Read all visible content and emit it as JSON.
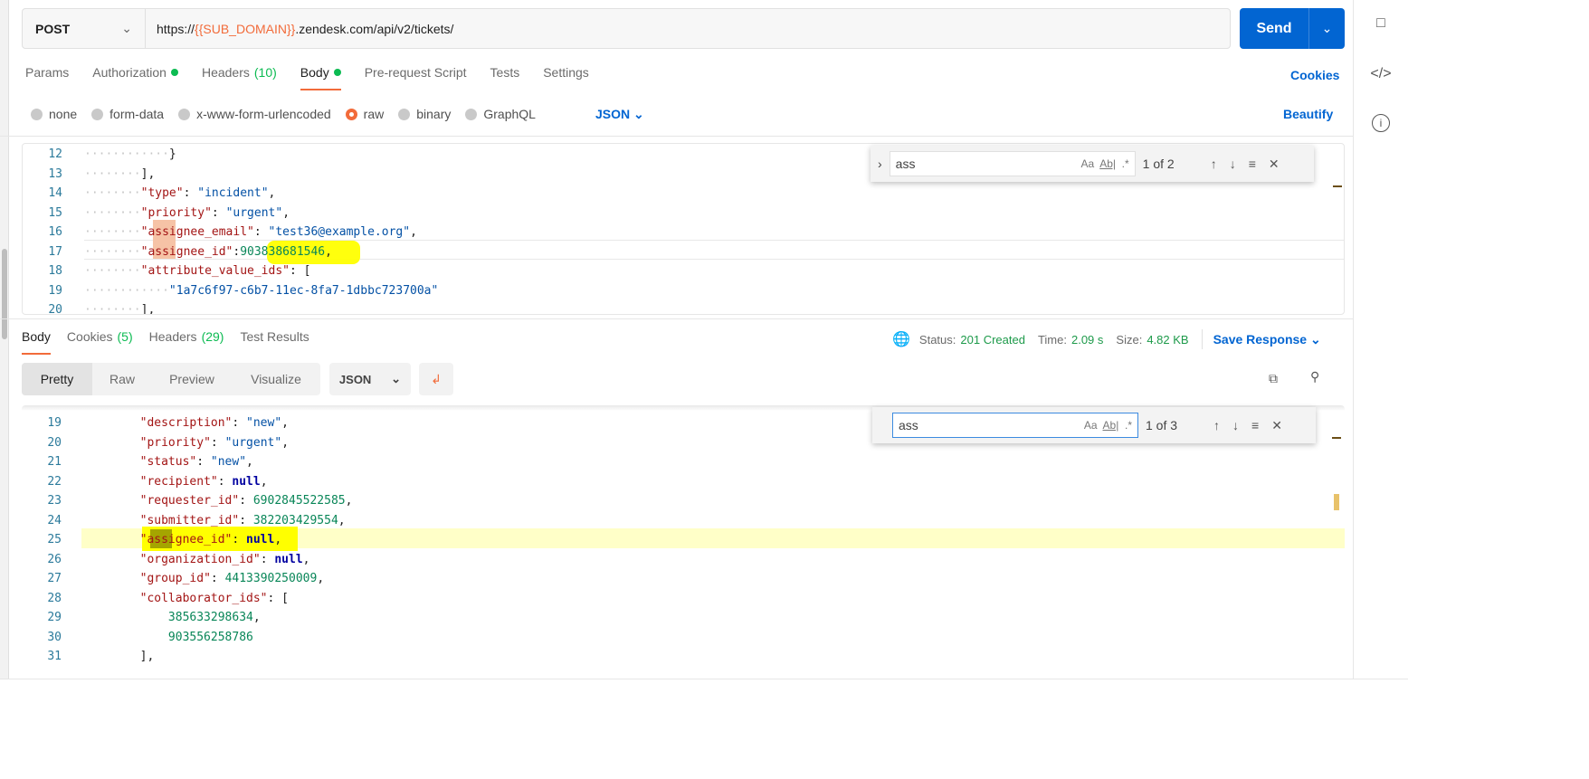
{
  "request": {
    "method": "POST",
    "url_prefix": "https://",
    "url_var": "{{SUB_DOMAIN}}",
    "url_suffix": ".zendesk.com/api/v2/tickets/",
    "send_label": "Send",
    "tabs": [
      {
        "label": "Params"
      },
      {
        "label": "Authorization",
        "dot": true
      },
      {
        "label": "Headers",
        "count": "(10)"
      },
      {
        "label": "Body",
        "dot": true,
        "active": true
      },
      {
        "label": "Pre-request Script"
      },
      {
        "label": "Tests"
      },
      {
        "label": "Settings"
      }
    ],
    "cookies_label": "Cookies",
    "body_types": [
      {
        "label": "none"
      },
      {
        "label": "form-data"
      },
      {
        "label": "x-www-form-urlencoded"
      },
      {
        "label": "raw",
        "selected": true
      },
      {
        "label": "binary"
      },
      {
        "label": "GraphQL"
      }
    ],
    "format": "JSON",
    "beautify_label": "Beautify",
    "find": {
      "value": "ass",
      "match_case": "Aa",
      "whole_word": "Ab|",
      "regex": ".*",
      "count": "1 of 2"
    },
    "lines": [
      {
        "num": "12",
        "indent": "            ",
        "tokens": [
          [
            "p",
            "}"
          ]
        ]
      },
      {
        "num": "13",
        "indent": "        ",
        "tokens": [
          [
            "p",
            "],"
          ]
        ]
      },
      {
        "num": "14",
        "indent": "        ",
        "tokens": [
          [
            "k",
            "\"type\""
          ],
          [
            "p",
            ": "
          ],
          [
            "s",
            "\"incident\""
          ],
          [
            "p",
            ","
          ]
        ]
      },
      {
        "num": "15",
        "indent": "        ",
        "tokens": [
          [
            "k",
            "\"priority\""
          ],
          [
            "p",
            ": "
          ],
          [
            "s",
            "\"urgent\""
          ],
          [
            "p",
            ","
          ]
        ]
      },
      {
        "num": "16",
        "indent": "        ",
        "tokens": [
          [
            "k",
            "\"assignee_email\""
          ],
          [
            "p",
            ": "
          ],
          [
            "s",
            "\"test36@example.org\""
          ],
          [
            "p",
            ","
          ]
        ]
      },
      {
        "num": "17",
        "indent": "        ",
        "tokens": [
          [
            "k",
            "\"assignee_id\""
          ],
          [
            "p",
            ":"
          ],
          [
            "n",
            "903838681546"
          ],
          [
            "p",
            ","
          ]
        ]
      },
      {
        "num": "18",
        "indent": "        ",
        "tokens": [
          [
            "k",
            "\"attribute_value_ids\""
          ],
          [
            "p",
            ": ["
          ]
        ]
      },
      {
        "num": "19",
        "indent": "            ",
        "tokens": [
          [
            "s",
            "\"1a7c6f97-c6b7-11ec-8fa7-1dbbc723700a\""
          ]
        ]
      },
      {
        "num": "20",
        "indent": "        ",
        "tokens": [
          [
            "p",
            "],"
          ]
        ]
      }
    ]
  },
  "response": {
    "tabs": [
      {
        "label": "Body",
        "active": true
      },
      {
        "label": "Cookies",
        "count": "(5)"
      },
      {
        "label": "Headers",
        "count": "(29)"
      },
      {
        "label": "Test Results"
      }
    ],
    "status_label": "Status:",
    "status": "201 Created",
    "time_label": "Time:",
    "time": "2.09 s",
    "size_label": "Size:",
    "size": "4.82 KB",
    "save_label": "Save Response",
    "views": [
      "Pretty",
      "Raw",
      "Preview",
      "Visualize"
    ],
    "format": "JSON",
    "find": {
      "value": "ass",
      "match_case": "Aa",
      "whole_word": "Ab|",
      "regex": ".*",
      "count": "1 of 3"
    },
    "lines": [
      {
        "num": "19",
        "indent": "        ",
        "tokens": [
          [
            "k",
            "\"description\""
          ],
          [
            "p",
            ": "
          ],
          [
            "s",
            "\"new\""
          ],
          [
            "p",
            ","
          ]
        ]
      },
      {
        "num": "20",
        "indent": "        ",
        "tokens": [
          [
            "k",
            "\"priority\""
          ],
          [
            "p",
            ": "
          ],
          [
            "s",
            "\"urgent\""
          ],
          [
            "p",
            ","
          ]
        ]
      },
      {
        "num": "21",
        "indent": "        ",
        "tokens": [
          [
            "k",
            "\"status\""
          ],
          [
            "p",
            ": "
          ],
          [
            "s",
            "\"new\""
          ],
          [
            "p",
            ","
          ]
        ]
      },
      {
        "num": "22",
        "indent": "        ",
        "tokens": [
          [
            "k",
            "\"recipient\""
          ],
          [
            "p",
            ": "
          ],
          [
            "kw",
            "null"
          ],
          [
            "p",
            ","
          ]
        ]
      },
      {
        "num": "23",
        "indent": "        ",
        "tokens": [
          [
            "k",
            "\"requester_id\""
          ],
          [
            "p",
            ": "
          ],
          [
            "n",
            "6902845522585"
          ],
          [
            "p",
            ","
          ]
        ]
      },
      {
        "num": "24",
        "indent": "        ",
        "tokens": [
          [
            "k",
            "\"submitter_id\""
          ],
          [
            "p",
            ": "
          ],
          [
            "n",
            "382203429554"
          ],
          [
            "p",
            ","
          ]
        ]
      },
      {
        "num": "25",
        "indent": "        ",
        "tokens": [
          [
            "k",
            "\"assignee_id\""
          ],
          [
            "p",
            ": "
          ],
          [
            "kw",
            "null"
          ],
          [
            "p",
            ","
          ]
        ]
      },
      {
        "num": "26",
        "indent": "        ",
        "tokens": [
          [
            "k",
            "\"organization_id\""
          ],
          [
            "p",
            ": "
          ],
          [
            "kw",
            "null"
          ],
          [
            "p",
            ","
          ]
        ]
      },
      {
        "num": "27",
        "indent": "        ",
        "tokens": [
          [
            "k",
            "\"group_id\""
          ],
          [
            "p",
            ": "
          ],
          [
            "n",
            "4413390250009"
          ],
          [
            "p",
            ","
          ]
        ]
      },
      {
        "num": "28",
        "indent": "        ",
        "tokens": [
          [
            "k",
            "\"collaborator_ids\""
          ],
          [
            "p",
            ": ["
          ]
        ]
      },
      {
        "num": "29",
        "indent": "            ",
        "tokens": [
          [
            "n",
            "385633298634"
          ],
          [
            "p",
            ","
          ]
        ]
      },
      {
        "num": "30",
        "indent": "            ",
        "tokens": [
          [
            "n",
            "903556258786"
          ]
        ]
      },
      {
        "num": "31",
        "indent": "        ",
        "tokens": [
          [
            "p",
            "],"
          ]
        ]
      }
    ]
  },
  "colors": {
    "accent": "#f26b3a",
    "primary": "#0265d2",
    "success": "#0cbb52",
    "highlight": "#ffff00"
  }
}
